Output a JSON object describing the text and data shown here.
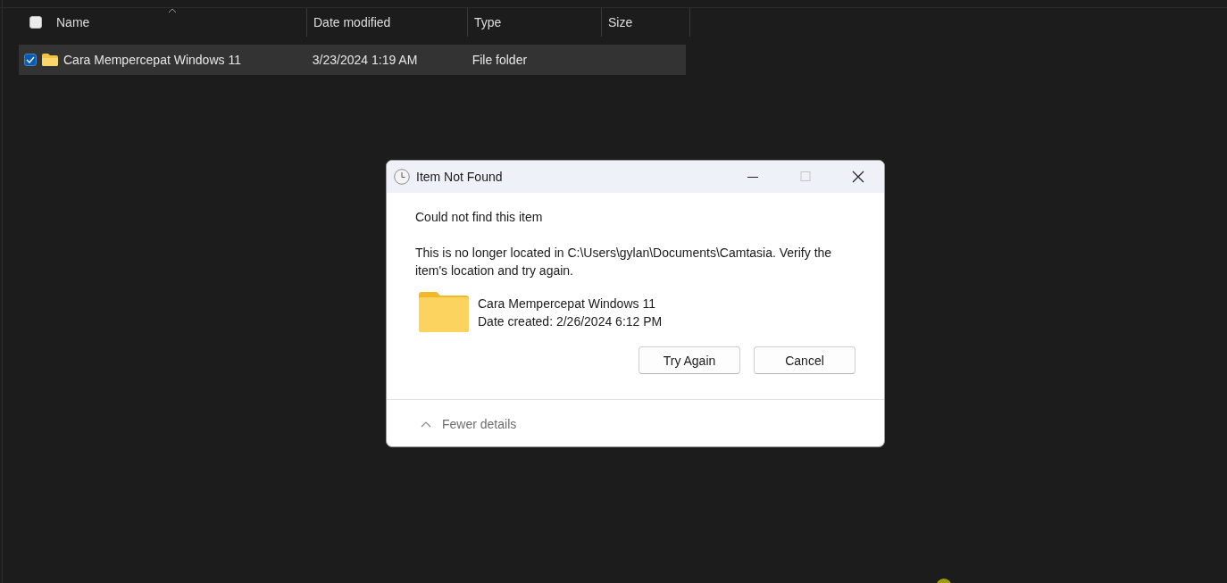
{
  "explorer": {
    "select_all": {
      "checked": false
    },
    "columns": [
      {
        "label": "Name",
        "sorted": true
      },
      {
        "label": "Date modified",
        "sorted": false
      },
      {
        "label": "Type",
        "sorted": false
      },
      {
        "label": "Size",
        "sorted": false
      }
    ],
    "rows": [
      {
        "name": "Cara Mempercepat Windows 11",
        "date_modified": "3/23/2024 1:19 AM",
        "type": "File folder",
        "selected": true,
        "checked": true
      }
    ]
  },
  "dialog": {
    "title": "Item Not Found",
    "heading": "Could not find this item",
    "message": "This is no longer located in C:\\Users\\gylan\\Documents\\Camtasia. Verify the item's location and try again.",
    "item": {
      "name": "Cara Mempercepat Windows 11",
      "date_created": "Date created: 2/26/2024 6:12 PM"
    },
    "buttons": [
      "Try Again",
      "Cancel"
    ],
    "details_toggle": {
      "label": "Fewer details",
      "expanded": true
    }
  }
}
